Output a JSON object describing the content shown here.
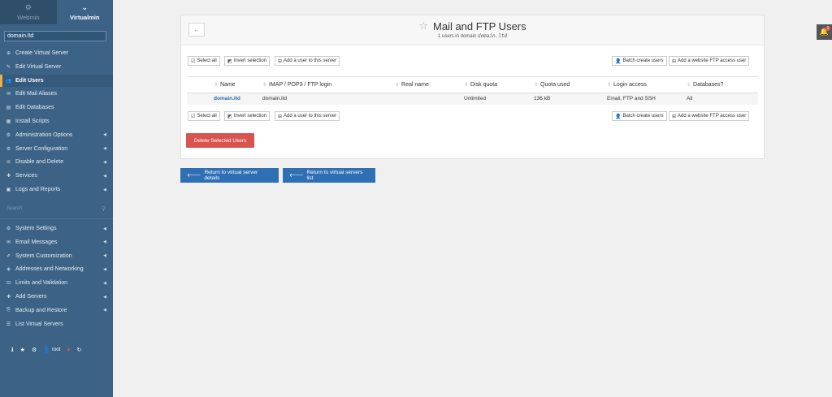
{
  "sidebar": {
    "tabs": [
      {
        "label": "Webmin",
        "icon": "webmin-icon"
      },
      {
        "label": "Virtualmin",
        "icon": "virtualmin-icon"
      }
    ],
    "domain": "domain.ltd",
    "items": [
      {
        "label": "Create Virtual Server",
        "icon": "create-icon",
        "caret": ""
      },
      {
        "label": "Edit Virtual Server",
        "icon": "edit-icon",
        "caret": ""
      },
      {
        "label": "Edit Users",
        "icon": "users-icon",
        "caret": ""
      },
      {
        "label": "Edit Mail Aliases",
        "icon": "mail-alias-icon",
        "caret": ""
      },
      {
        "label": "Edit Databases",
        "icon": "database-icon",
        "caret": ""
      },
      {
        "label": "Install Scripts",
        "icon": "scripts-icon",
        "caret": ""
      },
      {
        "label": "Administration Options",
        "icon": "admin-icon",
        "caret": "◀"
      },
      {
        "label": "Server Configuration",
        "icon": "config-icon",
        "caret": "◀"
      },
      {
        "label": "Disable and Delete",
        "icon": "disable-icon",
        "caret": "◀"
      },
      {
        "label": "Services",
        "icon": "services-icon",
        "caret": "◀"
      },
      {
        "label": "Logs and Reports",
        "icon": "logs-icon",
        "caret": "◀"
      }
    ],
    "search_placeholder": "Search",
    "items2": [
      {
        "label": "System Settings",
        "icon": "settings-icon",
        "caret": "◀"
      },
      {
        "label": "Email Messages",
        "icon": "email-icon",
        "caret": "◀"
      },
      {
        "label": "System Customization",
        "icon": "customize-icon",
        "caret": "◀"
      },
      {
        "label": "Addresses and Networking",
        "icon": "network-icon",
        "caret": "◀"
      },
      {
        "label": "Limits and Validation",
        "icon": "limits-icon",
        "caret": "◀"
      },
      {
        "label": "Add Servers",
        "icon": "add-icon",
        "caret": "◀"
      },
      {
        "label": "Backup and Restore",
        "icon": "backup-icon",
        "caret": "◀"
      },
      {
        "label": "List Virtual Servers",
        "icon": "list-icon",
        "caret": ""
      }
    ],
    "footer_user": "root"
  },
  "page": {
    "title": "Mail and FTP Users",
    "subtitle_prefix": "1 users in domain",
    "subtitle_domain": "domain.ltd"
  },
  "toolbar": {
    "select_all": "Select all",
    "invert_selection": "Invert selection",
    "add_user": "Add a user to this server",
    "batch_create": "Batch create users",
    "add_ftp": "Add a website FTP access user"
  },
  "table": {
    "headers": [
      "Name",
      "IMAP / POP3 / FTP login",
      "Real name",
      "Disk quota",
      "Quota used",
      "Login access",
      "Databases?"
    ],
    "rows": [
      [
        "domain.ltd",
        "domain.ltd",
        "",
        "Unlimited",
        "136 kB",
        "Email, FTP and SSH",
        "All"
      ]
    ]
  },
  "actions": {
    "delete_selected": "Delete Selected Users",
    "return_details": "Return to virtual server details",
    "return_list": "Return to virtual servers list"
  },
  "notifications": {
    "count": "1"
  },
  "colors": {
    "sidebar": "#3c6386",
    "accent": "#f0ad4e",
    "danger": "#d9534f",
    "primary": "#2f6fb3"
  }
}
